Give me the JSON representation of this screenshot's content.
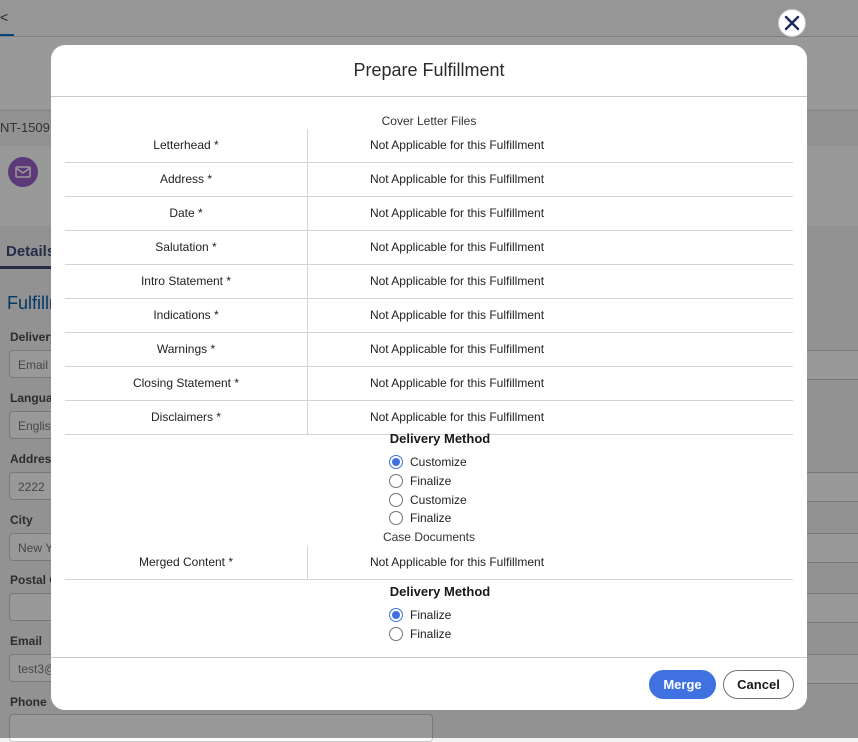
{
  "background": {
    "tab_glyph": "<",
    "record_id": "NT-1509",
    "details_tab": "Details",
    "section_title": "Fulfillm",
    "fields": [
      {
        "label": "Delivery",
        "value": "Email"
      },
      {
        "label": "Langua",
        "value": "Englis"
      },
      {
        "label": "Address",
        "value": "2222"
      },
      {
        "label": "City",
        "value": "New Y"
      },
      {
        "label": "Postal C",
        "value": ""
      },
      {
        "label": "Email",
        "value": "test3@"
      },
      {
        "label": "Phone",
        "value": ""
      }
    ]
  },
  "modal": {
    "title": "Prepare Fulfillment",
    "close_icon": "close-icon",
    "cover_letter_caption": "Cover Letter Files",
    "cover_letter_rows": [
      {
        "label": "Letterhead *",
        "value": "Not Applicable for this Fulfillment"
      },
      {
        "label": "Address *",
        "value": "Not Applicable for this Fulfillment"
      },
      {
        "label": "Date *",
        "value": "Not Applicable for this Fulfillment"
      },
      {
        "label": "Salutation *",
        "value": "Not Applicable for this Fulfillment"
      },
      {
        "label": "Intro Statement *",
        "value": "Not Applicable for this Fulfillment"
      },
      {
        "label": "Indications *",
        "value": "Not Applicable for this Fulfillment"
      },
      {
        "label": "Warnings *",
        "value": "Not Applicable for this Fulfillment"
      },
      {
        "label": "Closing Statement *",
        "value": "Not Applicable for this Fulfillment"
      },
      {
        "label": "Disclaimers *",
        "value": "Not Applicable for this Fulfillment"
      }
    ],
    "delivery_method_1": {
      "title": "Delivery Method",
      "options": [
        {
          "label": "Customize",
          "checked": true
        },
        {
          "label": "Finalize",
          "checked": false
        },
        {
          "label": "Customize",
          "checked": false
        },
        {
          "label": "Finalize",
          "checked": false
        }
      ]
    },
    "case_documents_caption": "Case Documents",
    "case_documents_rows": [
      {
        "label": "Merged Content *",
        "value": "Not Applicable for this Fulfillment"
      }
    ],
    "delivery_method_2": {
      "title": "Delivery Method",
      "options": [
        {
          "label": "Finalize",
          "checked": true
        },
        {
          "label": "Finalize",
          "checked": false
        }
      ]
    },
    "buttons": {
      "merge": "Merge",
      "cancel": "Cancel"
    },
    "accent_color": "#3f72e0"
  }
}
